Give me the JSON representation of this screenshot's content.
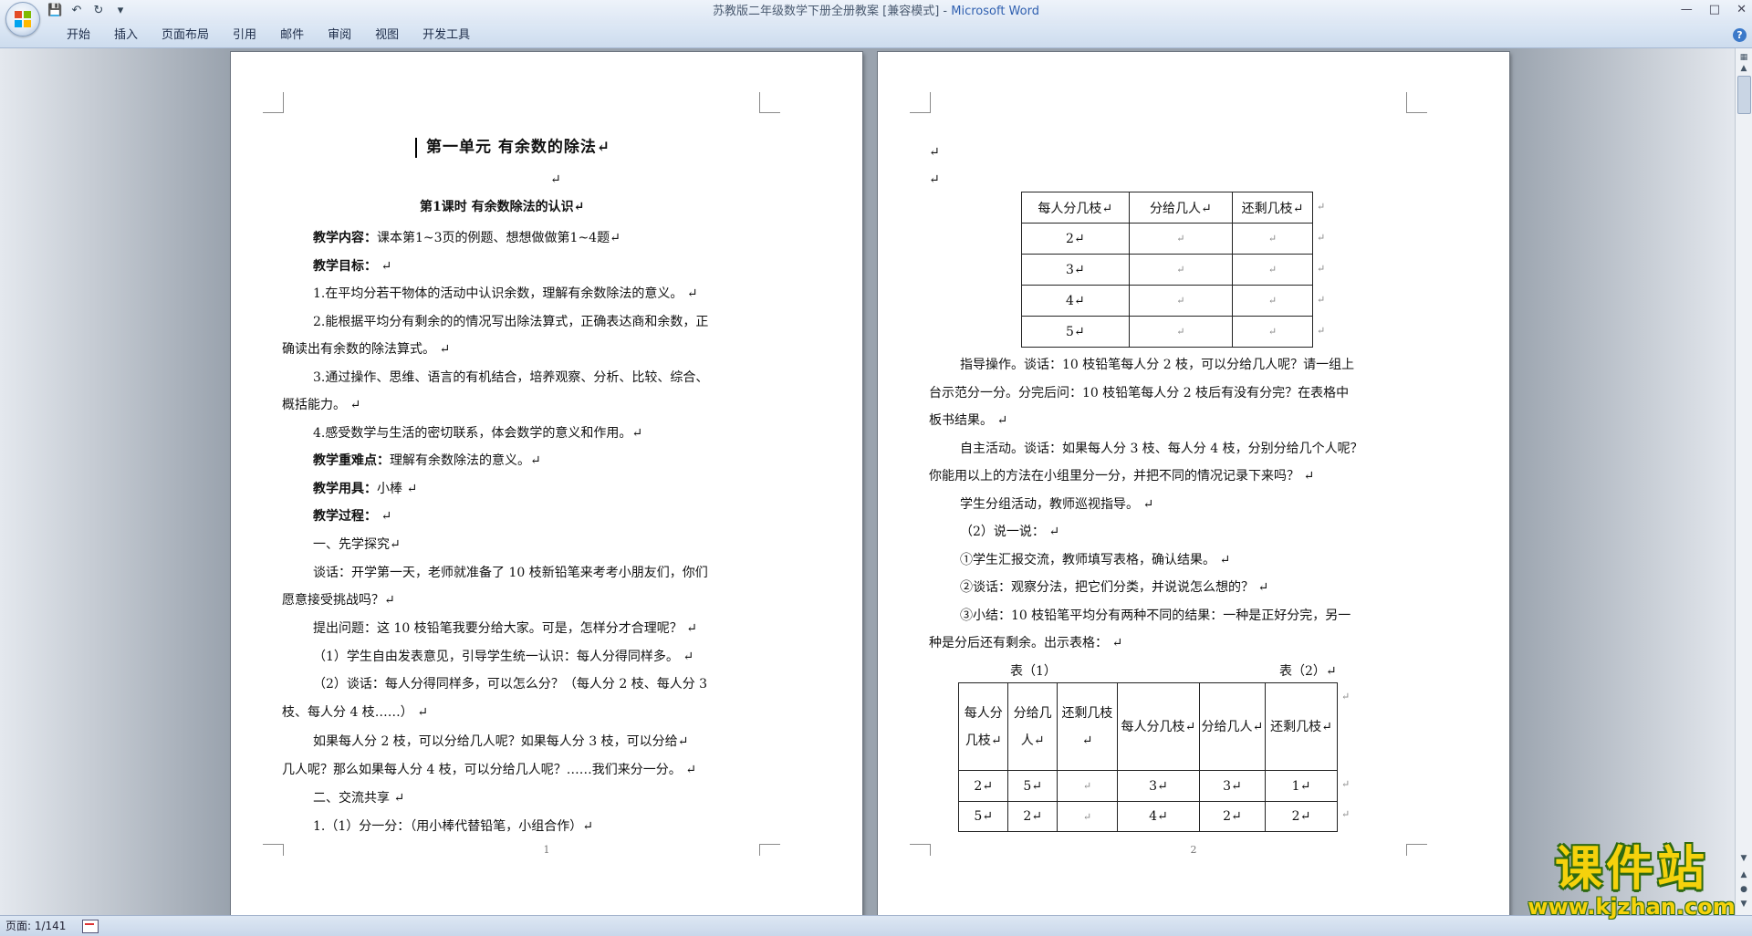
{
  "window": {
    "title": "苏教版二年级数学下册全册教案 [兼容模式] - ",
    "app_name": "Microsoft Word"
  },
  "ribbon": {
    "tabs": [
      "开始",
      "插入",
      "页面布局",
      "引用",
      "邮件",
      "审阅",
      "视图",
      "开发工具"
    ]
  },
  "page1": {
    "unit_title": "第一单元  有余数的除法↵",
    "empty_mark": "↵",
    "lesson_title": "第1课时      有余数除法的认识↵",
    "lines": [
      {
        "bold": "教学内容：",
        "text": "课本第1~3页的例题、想想做做第1~4题↵"
      },
      {
        "bold": "教学目标：",
        "text": " ↵"
      },
      {
        "bold": "",
        "text": "1.在平均分若干物体的活动中认识余数，理解有余数除法的意义。 ↵"
      },
      {
        "bold": "",
        "text": "2.能根据平均分有剩余的的情况写出除法算式，正确表达商和余数，正"
      },
      {
        "bold": "",
        "text": "确读出有余数的除法算式。 ↵"
      },
      {
        "bold": "",
        "text": "3.通过操作、思维、语言的有机结合，培养观察、分析、比较、综合、"
      },
      {
        "bold": "",
        "text": "概括能力。 ↵"
      },
      {
        "bold": "",
        "text": "4.感受数学与生活的密切联系，体会数学的意义和作用。↵"
      },
      {
        "bold": "教学重难点：",
        "text": "理解有余数除法的意义。↵"
      },
      {
        "bold": "教学用具：",
        "text": "小棒 ↵"
      },
      {
        "bold": "教学过程：",
        "text": " ↵"
      },
      {
        "bold": "",
        "text": "一、先学探究↵"
      },
      {
        "bold": "",
        "text": "谈话：开学第一天，老师就准备了 10 枝新铅笔来考考小朋友们，你们"
      },
      {
        "bold": "",
        "text": "愿意接受挑战吗？↵"
      },
      {
        "bold": "",
        "text": "提出问题：这 10 枝铅笔我要分给大家。可是，怎样分才合理呢？ ↵"
      },
      {
        "bold": "",
        "text": "（1）学生自由发表意见，引导学生统一认识：每人分得同样多。 ↵"
      },
      {
        "bold": "",
        "text": "（2）谈话：每人分得同样多，可以怎么分？（每人分  2  枝、每人分  3"
      },
      {
        "bold": "",
        "text": "枝、每人分 4 枝……） ↵"
      },
      {
        "bold": "",
        "text": "如果每人分 2 枝，可以分给几人呢？如果每人分 3 枝，可以分给↵"
      },
      {
        "bold": "",
        "text": "几人呢？那么如果每人分 4 枝，可以分给几人呢？……我们来分一分。 ↵"
      },
      {
        "bold": "",
        "text": "二、交流共享 ↵"
      },
      {
        "bold": "",
        "text": "1.（1）分一分：（用小棒代替铅笔，小组合作）↵"
      }
    ],
    "page_number": "1"
  },
  "page2": {
    "empty_marks": [
      "↵",
      "↵"
    ],
    "table1": {
      "headers": [
        "每人分几枝↵",
        "分给几人↵",
        "还剩几枝↵"
      ],
      "rows": [
        [
          "2↵",
          "↵",
          "↵"
        ],
        [
          "3↵",
          "↵",
          "↵"
        ],
        [
          "4↵",
          "↵",
          "↵"
        ],
        [
          "5↵",
          "↵",
          "↵"
        ]
      ],
      "row_end": "↵"
    },
    "lines": [
      "指导操作。谈话：10 枝铅笔每人分 2 枝，可以分给几人呢？请一组上",
      "台示范分一分。分完后问：10 枝铅笔每人分 2 枝后有没有分完？在表格中",
      "板书结果。 ↵",
      "自主活动。谈话：如果每人分 3 枝、每人分 4 枝，分别分给几个人呢？",
      "你能用以上的方法在小组里分一分，并把不同的情况记录下来吗？ ↵",
      "学生分组活动，教师巡视指导。 ↵",
      "（2）说一说： ↵",
      "①学生汇报交流，教师填写表格，确认结果。 ↵",
      "②谈话：观察分法，把它们分类，并说说怎么想的？ ↵",
      "③小结：10 枝铅笔平均分有两种不同的结果：一种是正好分完，另一",
      "种是分后还有剩余。出示表格： ↵"
    ],
    "table_caption_1": "表（1）",
    "table_caption_2": "表（2）↵",
    "table2": {
      "headers": [
        "每人分几枝↵",
        "分给几人↵",
        "还剩几枝↵",
        "每人分几枝↵",
        "分给几人↵",
        "还剩几枝↵"
      ],
      "rows": [
        [
          "2↵",
          "5↵",
          "↵",
          "3↵",
          "3↵",
          "1↵"
        ],
        [
          "5↵",
          "2↵",
          "↵",
          "4↵",
          "2↵",
          "2↵"
        ]
      ],
      "row_end": "↵"
    },
    "page_number": "2"
  },
  "status": {
    "page_info": "页面: 1/141"
  },
  "watermark": {
    "main": "课件站",
    "url": "www.kjzhan.com"
  }
}
